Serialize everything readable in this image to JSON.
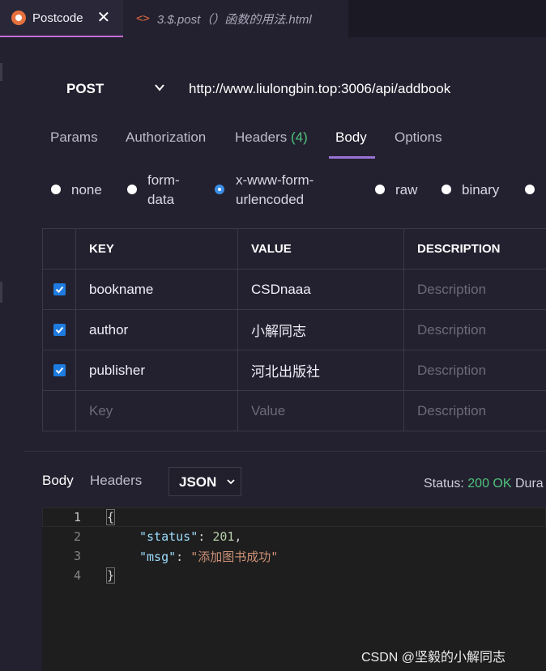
{
  "tabs": {
    "active": {
      "title": "Postcode",
      "close": "✕"
    },
    "file": {
      "code_icon": "<>",
      "title": "3.$.post（）函数的用法.html"
    }
  },
  "request": {
    "method": "POST",
    "url": "http://www.liulongbin.top:3006/api/addbook"
  },
  "request_tabs": [
    {
      "label": "Params"
    },
    {
      "label": "Authorization"
    },
    {
      "label": "Headers",
      "count": "(4)"
    },
    {
      "label": "Body"
    },
    {
      "label": "Options"
    }
  ],
  "body_types": {
    "none": "none",
    "form_data_line1": "form-",
    "form_data_line2": "data",
    "urlencoded_line1": "x-www-form-",
    "urlencoded_line2": "urlencoded",
    "raw": "raw",
    "binary": "binary",
    "selected": "x-www-form-urlencoded"
  },
  "table": {
    "headers": {
      "key": "KEY",
      "value": "VALUE",
      "description": "DESCRIPTION"
    },
    "rows": [
      {
        "checked": true,
        "key": "bookname",
        "value": "CSDnaaa",
        "description": "Description"
      },
      {
        "checked": true,
        "key": "author",
        "value": "小解同志",
        "description": "Description"
      },
      {
        "checked": true,
        "key": "publisher",
        "value": "河北出版社",
        "description": "Description"
      }
    ],
    "empty_row": {
      "key": "Key",
      "value": "Value",
      "description": "Description"
    }
  },
  "response": {
    "tabs": {
      "body": "Body",
      "headers": "Headers"
    },
    "format": "JSON",
    "status_label": "Status:",
    "status_value": "200 OK",
    "duration_label": "Dura"
  },
  "editor": {
    "line_numbers": [
      "1",
      "2",
      "3",
      "4"
    ],
    "open_brace": "{",
    "close_brace": "}",
    "status_key": "\"status\"",
    "status_value": "201",
    "msg_key": "\"msg\"",
    "msg_value": "\"添加图书成功\""
  },
  "watermark": "CSDN @坚毅的小解同志",
  "colors": {
    "background": "#23212f",
    "accent_underline": "#9a73d5",
    "checkbox_blue": "#1e7be0",
    "status_green": "#4ec27c"
  }
}
